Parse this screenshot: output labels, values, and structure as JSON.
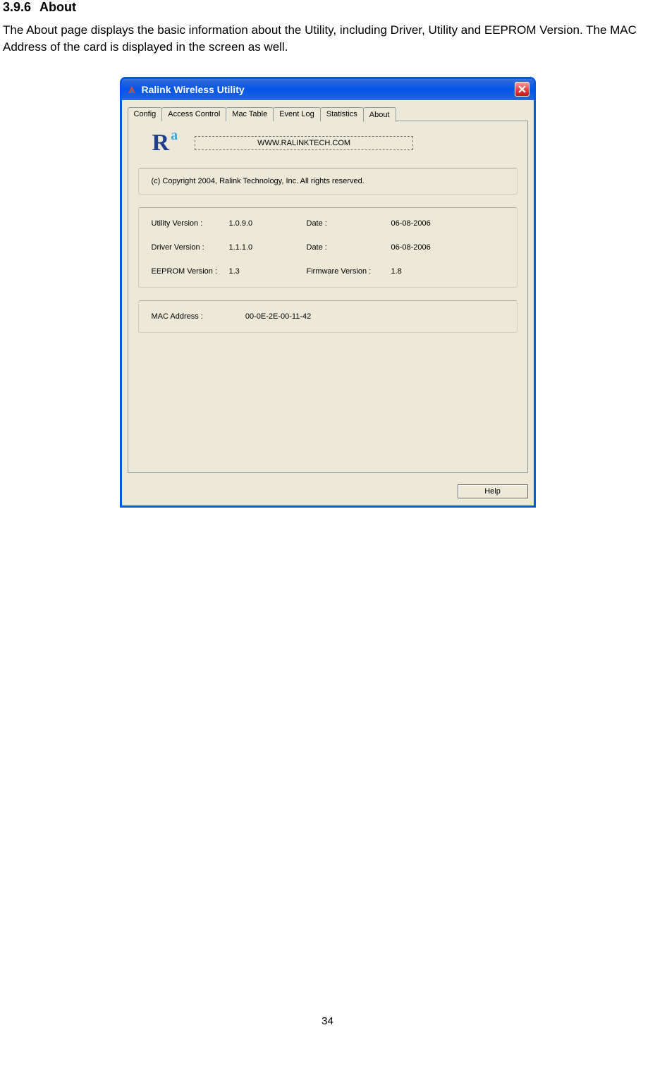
{
  "doc": {
    "heading_num": "3.9.6",
    "heading_title": "About",
    "description": "The About page displays the basic information about the Utility, including Driver, Utility and EEPROM Version. The MAC Address of the card is displayed in the screen as well.",
    "page_number": "34"
  },
  "window": {
    "title": "Ralink Wireless Utility",
    "tabs": [
      {
        "label": "Config"
      },
      {
        "label": "Access Control"
      },
      {
        "label": "Mac Table"
      },
      {
        "label": "Event Log"
      },
      {
        "label": "Statistics"
      },
      {
        "label": "About"
      }
    ],
    "url_button": "WWW.RALINKTECH.COM",
    "copyright": "(c) Copyright 2004, Ralink Technology, Inc.  All rights reserved.",
    "versions": {
      "utility_label": "Utility Version :",
      "utility_value": "1.0.9.0",
      "utility_date_label": "Date :",
      "utility_date_value": "06-08-2006",
      "driver_label": "Driver Version :",
      "driver_value": "1.1.1.0",
      "driver_date_label": "Date :",
      "driver_date_value": "06-08-2006",
      "eeprom_label": "EEPROM Version :",
      "eeprom_value": "1.3",
      "firmware_label": "Firmware Version :",
      "firmware_value": "1.8"
    },
    "mac": {
      "label": "MAC Address :",
      "value": "00-0E-2E-00-11-42"
    },
    "help_button": "Help"
  }
}
